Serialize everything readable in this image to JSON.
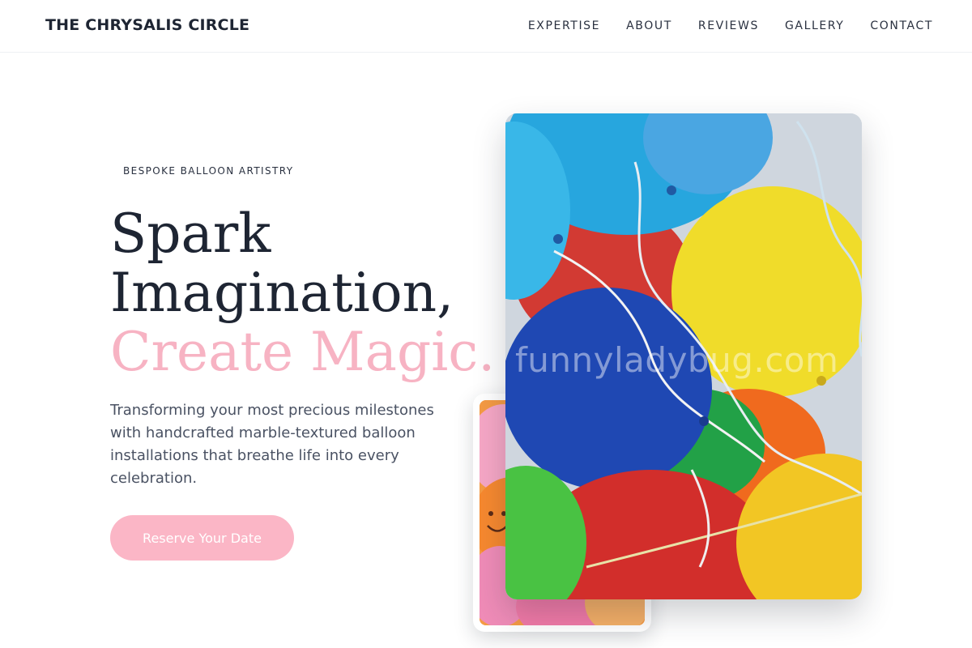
{
  "header": {
    "brand": "THE CHRYSALIS CIRCLE",
    "nav": [
      "EXPERTISE",
      "ABOUT",
      "REVIEWS",
      "GALLERY",
      "CONTACT"
    ]
  },
  "hero": {
    "eyebrow": "BESPOKE BALLOON ARTISTRY",
    "headline_line1": "Spark",
    "headline_line2": "Imagination,",
    "headline_accent": "Create Magic.",
    "description": "Transforming your most precious milestones with handcrafted marble-textured balloon installations that breathe life into every celebration.",
    "cta_label": "Reserve Your Date"
  },
  "media": {
    "main_photo_subject": "colorful balloons with curled ribbons",
    "small_photo_subject": "balloons with smiley faces",
    "watermark": "funnyladybug.com"
  },
  "colors": {
    "text_dark": "#1e2533",
    "accent_pink": "#f7b3c3",
    "button_pink": "#fbb6c6",
    "body_text": "#4a5263"
  }
}
